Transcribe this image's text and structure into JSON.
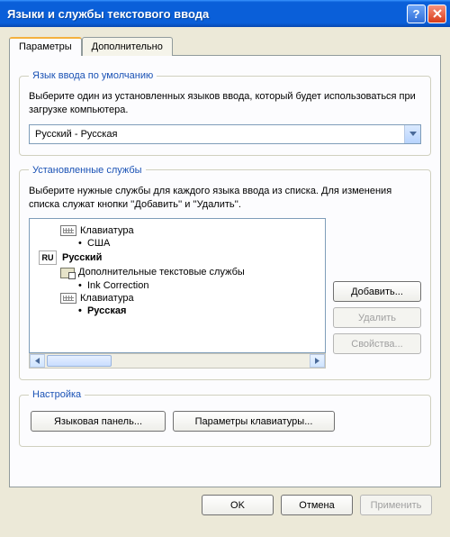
{
  "window": {
    "title": "Языки и службы текстового ввода"
  },
  "tabs": {
    "params": "Параметры",
    "advanced": "Дополнительно"
  },
  "defaultLang": {
    "legend": "Язык ввода по умолчанию",
    "desc": "Выберите один из установленных языков ввода, который будет использоваться при загрузке компьютера.",
    "selected": "Русский - Русская"
  },
  "services": {
    "legend": "Установленные службы",
    "desc": "Выберите нужные службы для каждого языка ввода из списка. Для изменения списка служат кнопки ''Добавить'' и ''Удалить''.",
    "tree": {
      "kb_en_header": "Клавиатура",
      "kb_en_layout": "США",
      "ru_badge": "RU",
      "ru_lang": "Русский",
      "ru_extra_header": "Дополнительные текстовые службы",
      "ru_extra_item": "Ink Correction",
      "kb_ru_header": "Клавиатура",
      "kb_ru_layout": "Русская"
    },
    "buttons": {
      "add": "Добавить...",
      "remove": "Удалить",
      "props": "Свойства..."
    }
  },
  "settings": {
    "legend": "Настройка",
    "langbar": "Языковая панель...",
    "kbparams": "Параметры клавиатуры..."
  },
  "dlg": {
    "ok": "OK",
    "cancel": "Отмена",
    "apply": "Применить"
  }
}
